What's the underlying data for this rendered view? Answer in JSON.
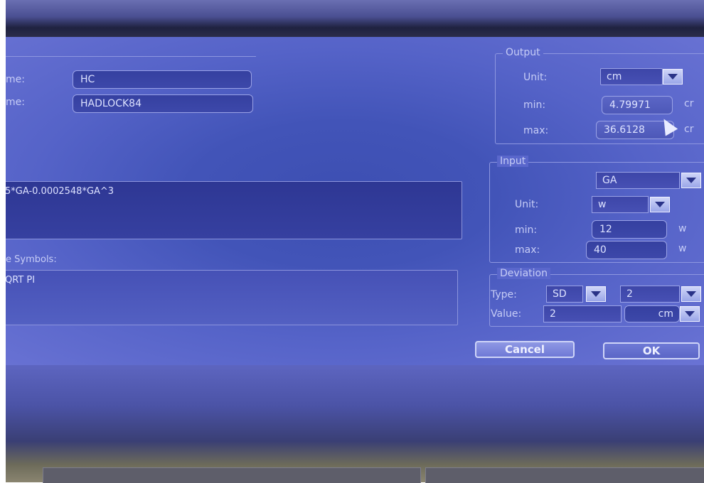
{
  "left": {
    "name_label": "me:",
    "name_value": "HC",
    "author_label": "me:",
    "author_value": "HADLOCK84",
    "formula_value": "5*GA-0.0002548*GA^3",
    "symbols_label": "e Symbols:",
    "symbols_value": "QRT PI"
  },
  "output": {
    "legend": "Output",
    "unit_label": "Unit:",
    "unit_value": "cm",
    "min_label": "min:",
    "min_value": "4.79971",
    "min_unit": "cr",
    "max_label": "max:",
    "max_value": "36.6128",
    "max_unit": "cr"
  },
  "input": {
    "legend": "Input",
    "param_value": "GA",
    "unit_label": "Unit:",
    "unit_value": "w",
    "min_label": "min:",
    "min_value": "12",
    "min_unit": "w",
    "max_label": "max:",
    "max_value": "40",
    "max_unit": "w"
  },
  "deviation": {
    "legend": "Deviation",
    "type_label": "Type:",
    "type_value": "SD",
    "type_second_value": "2",
    "value_label": "Value:",
    "value_value": "2",
    "value_unit": "cm"
  },
  "buttons": {
    "cancel": "Cancel",
    "ok": "OK"
  }
}
